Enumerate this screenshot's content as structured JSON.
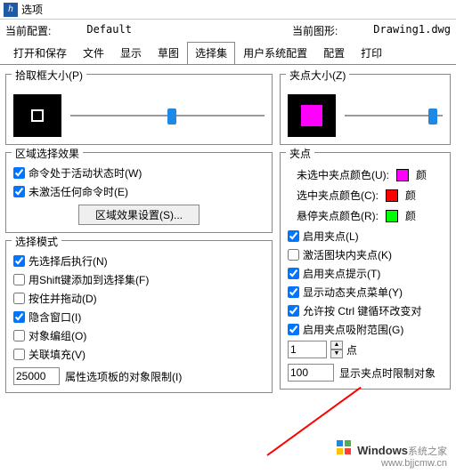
{
  "titlebar": {
    "icon": "h",
    "title": "选项"
  },
  "config": {
    "current_profile_label": "当前配置:",
    "current_profile_value": "Default",
    "current_drawing_label": "当前图形:",
    "current_drawing_value": "Drawing1.dwg"
  },
  "tabs": [
    {
      "label": "打开和保存"
    },
    {
      "label": "文件"
    },
    {
      "label": "显示"
    },
    {
      "label": "草图"
    },
    {
      "label": "选择集",
      "active": true
    },
    {
      "label": "用户系统配置"
    },
    {
      "label": "配置"
    },
    {
      "label": "打印"
    }
  ],
  "left": {
    "pickbox": {
      "title": "拾取框大小(P)"
    },
    "region": {
      "title": "区域选择效果",
      "active_cmd": "命令处于活动状态时(W)",
      "no_active_cmd": "未激活任何命令时(E)",
      "settings_btn": "区域效果设置(S)..."
    },
    "mode": {
      "title": "选择模式",
      "pre_select": "先选择后执行(N)",
      "shift_add": "用Shift键添加到选择集(F)",
      "press_drag": "按住并拖动(D)",
      "implied_window": "隐含窗口(I)",
      "object_group": "对象编组(O)",
      "assoc_hatch": "关联填充(V)",
      "obj_limit_value": "25000",
      "obj_limit_label": "属性选项板的对象限制(I)"
    }
  },
  "right": {
    "gripsize": {
      "title": "夹点大小(Z)"
    },
    "grips": {
      "title": "夹点",
      "unselected_label": "未选中夹点颜色(U):",
      "unselected_color": "#ff00ff",
      "unselected_text": "颜",
      "selected_label": "选中夹点颜色(C):",
      "selected_color": "#ff0000",
      "selected_text": "颜",
      "hover_label": "悬停夹点颜色(R):",
      "hover_color": "#00ff00",
      "hover_text": "颜",
      "enable_grips": "启用夹点(L)",
      "activate_block": "激活图块内夹点(K)",
      "enable_tips": "启用夹点提示(T)",
      "show_dynamic": "显示动态夹点菜单(Y)",
      "allow_ctrl": "允许按 Ctrl 键循环改变对",
      "enable_snap": "启用夹点吸附范围(G)",
      "point_value": "1",
      "point_label": "点",
      "limit_value": "100",
      "limit_label": "显示夹点时限制对象"
    }
  },
  "watermark": {
    "brand": "Windows",
    "suffix": "系统之家",
    "url": "www.bjjcmw.cn"
  }
}
